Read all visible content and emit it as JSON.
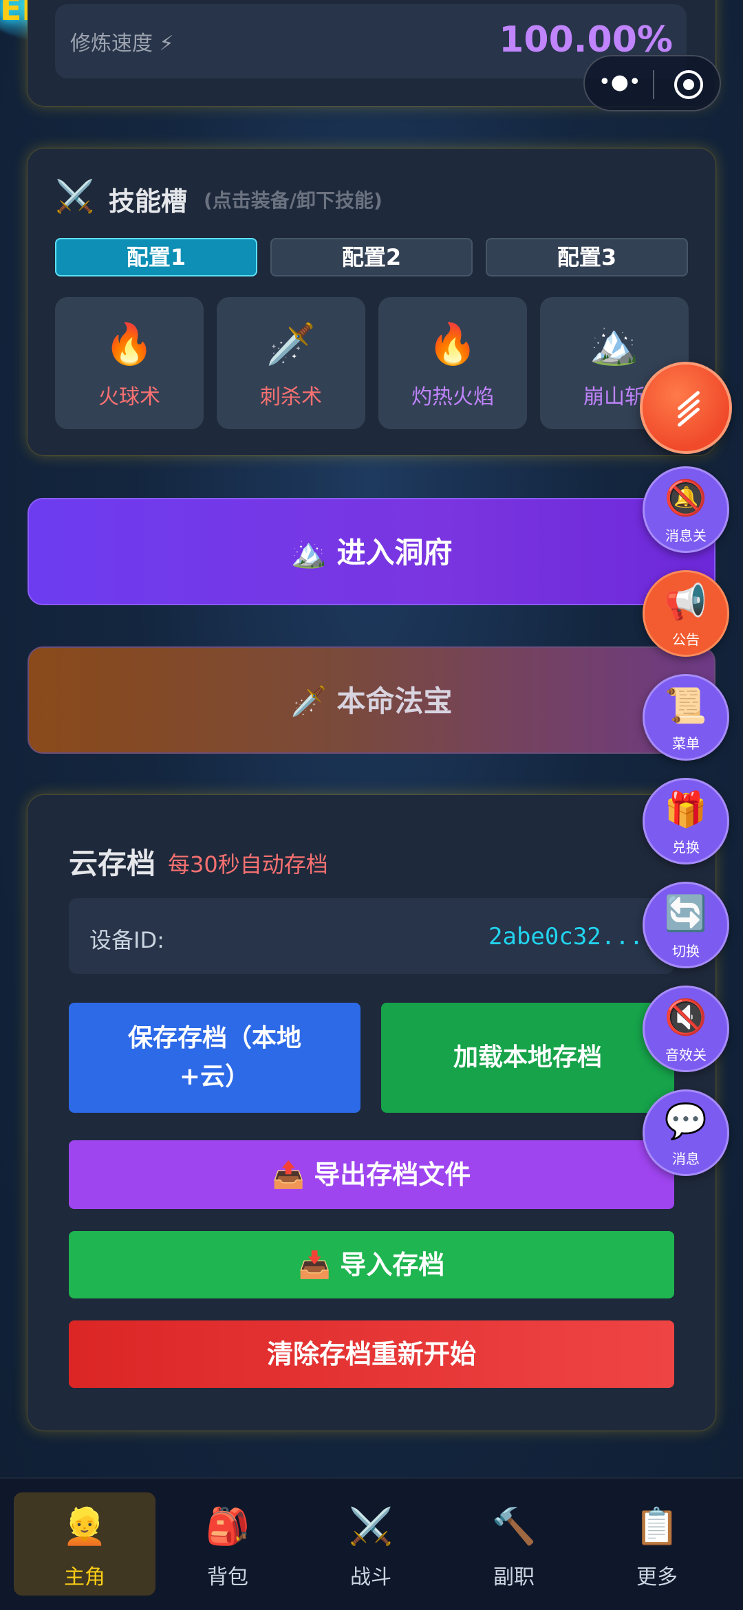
{
  "corner_badge": "EI",
  "cultivation": {
    "speed_label": "修炼速度 ⚡",
    "speed_value": "100.00%"
  },
  "capsule": {
    "more_icon": "•●•",
    "close_icon": "target-icon"
  },
  "skills": {
    "title_icon": "⚔️",
    "title": "技能槽",
    "hint": "(点击装备/卸下技能)",
    "configs": [
      "配置1",
      "配置2",
      "配置3"
    ],
    "active_config": 0,
    "slots": [
      {
        "icon": "🔥",
        "name": "火球术",
        "color": "#f87171"
      },
      {
        "icon": "🗡️",
        "name": "刺杀术",
        "color": "#f87171"
      },
      {
        "icon": "🔥",
        "name": "灼热火焰",
        "color": "#c084fc"
      },
      {
        "icon": "🏔️",
        "name": "崩山斩",
        "color": "#c084fc"
      }
    ]
  },
  "actions": {
    "enter_cave": "🏔️ 进入洞府",
    "artifact": "🗡️ 本命法宝"
  },
  "cloud_save": {
    "title": "云存档",
    "subtitle": "每30秒自动存档",
    "device_label": "设备ID:",
    "device_id": "2abe0c32...",
    "save_line1": "保存存档（本地",
    "save_line2": "+云）",
    "load": "加载本地存档",
    "export": "📤 导出存档文件",
    "import": "📥 导入存档",
    "clear": "清除存档重新开始"
  },
  "floating": {
    "main_icon": "menu-lines-icon",
    "items": [
      {
        "icon": "🔕",
        "label": "消息关"
      },
      {
        "icon": "📢",
        "label": "公告"
      },
      {
        "icon": "📜",
        "label": "菜单"
      },
      {
        "icon": "🎁",
        "label": "兑换"
      },
      {
        "icon": "🔄",
        "label": "切换"
      },
      {
        "icon": "🔇",
        "label": "音效关"
      },
      {
        "icon": "💬",
        "label": "消息"
      }
    ]
  },
  "nav": {
    "active": 0,
    "items": [
      {
        "icon": "👱",
        "label": "主角"
      },
      {
        "icon": "🎒",
        "label": "背包"
      },
      {
        "icon": "⚔️",
        "label": "战斗"
      },
      {
        "icon": "🔨",
        "label": "副职"
      },
      {
        "icon": "📋",
        "label": "更多"
      }
    ]
  }
}
